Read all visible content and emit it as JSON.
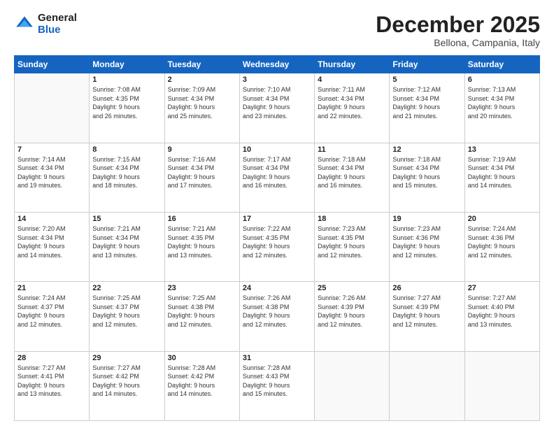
{
  "header": {
    "logo_general": "General",
    "logo_blue": "Blue",
    "month": "December 2025",
    "location": "Bellona, Campania, Italy"
  },
  "weekdays": [
    "Sunday",
    "Monday",
    "Tuesday",
    "Wednesday",
    "Thursday",
    "Friday",
    "Saturday"
  ],
  "weeks": [
    [
      {
        "day": "",
        "info": ""
      },
      {
        "day": "1",
        "info": "Sunrise: 7:08 AM\nSunset: 4:35 PM\nDaylight: 9 hours\nand 26 minutes."
      },
      {
        "day": "2",
        "info": "Sunrise: 7:09 AM\nSunset: 4:34 PM\nDaylight: 9 hours\nand 25 minutes."
      },
      {
        "day": "3",
        "info": "Sunrise: 7:10 AM\nSunset: 4:34 PM\nDaylight: 9 hours\nand 23 minutes."
      },
      {
        "day": "4",
        "info": "Sunrise: 7:11 AM\nSunset: 4:34 PM\nDaylight: 9 hours\nand 22 minutes."
      },
      {
        "day": "5",
        "info": "Sunrise: 7:12 AM\nSunset: 4:34 PM\nDaylight: 9 hours\nand 21 minutes."
      },
      {
        "day": "6",
        "info": "Sunrise: 7:13 AM\nSunset: 4:34 PM\nDaylight: 9 hours\nand 20 minutes."
      }
    ],
    [
      {
        "day": "7",
        "info": "Sunrise: 7:14 AM\nSunset: 4:34 PM\nDaylight: 9 hours\nand 19 minutes."
      },
      {
        "day": "8",
        "info": "Sunrise: 7:15 AM\nSunset: 4:34 PM\nDaylight: 9 hours\nand 18 minutes."
      },
      {
        "day": "9",
        "info": "Sunrise: 7:16 AM\nSunset: 4:34 PM\nDaylight: 9 hours\nand 17 minutes."
      },
      {
        "day": "10",
        "info": "Sunrise: 7:17 AM\nSunset: 4:34 PM\nDaylight: 9 hours\nand 16 minutes."
      },
      {
        "day": "11",
        "info": "Sunrise: 7:18 AM\nSunset: 4:34 PM\nDaylight: 9 hours\nand 16 minutes."
      },
      {
        "day": "12",
        "info": "Sunrise: 7:18 AM\nSunset: 4:34 PM\nDaylight: 9 hours\nand 15 minutes."
      },
      {
        "day": "13",
        "info": "Sunrise: 7:19 AM\nSunset: 4:34 PM\nDaylight: 9 hours\nand 14 minutes."
      }
    ],
    [
      {
        "day": "14",
        "info": "Sunrise: 7:20 AM\nSunset: 4:34 PM\nDaylight: 9 hours\nand 14 minutes."
      },
      {
        "day": "15",
        "info": "Sunrise: 7:21 AM\nSunset: 4:34 PM\nDaylight: 9 hours\nand 13 minutes."
      },
      {
        "day": "16",
        "info": "Sunrise: 7:21 AM\nSunset: 4:35 PM\nDaylight: 9 hours\nand 13 minutes."
      },
      {
        "day": "17",
        "info": "Sunrise: 7:22 AM\nSunset: 4:35 PM\nDaylight: 9 hours\nand 12 minutes."
      },
      {
        "day": "18",
        "info": "Sunrise: 7:23 AM\nSunset: 4:35 PM\nDaylight: 9 hours\nand 12 minutes."
      },
      {
        "day": "19",
        "info": "Sunrise: 7:23 AM\nSunset: 4:36 PM\nDaylight: 9 hours\nand 12 minutes."
      },
      {
        "day": "20",
        "info": "Sunrise: 7:24 AM\nSunset: 4:36 PM\nDaylight: 9 hours\nand 12 minutes."
      }
    ],
    [
      {
        "day": "21",
        "info": "Sunrise: 7:24 AM\nSunset: 4:37 PM\nDaylight: 9 hours\nand 12 minutes."
      },
      {
        "day": "22",
        "info": "Sunrise: 7:25 AM\nSunset: 4:37 PM\nDaylight: 9 hours\nand 12 minutes."
      },
      {
        "day": "23",
        "info": "Sunrise: 7:25 AM\nSunset: 4:38 PM\nDaylight: 9 hours\nand 12 minutes."
      },
      {
        "day": "24",
        "info": "Sunrise: 7:26 AM\nSunset: 4:38 PM\nDaylight: 9 hours\nand 12 minutes."
      },
      {
        "day": "25",
        "info": "Sunrise: 7:26 AM\nSunset: 4:39 PM\nDaylight: 9 hours\nand 12 minutes."
      },
      {
        "day": "26",
        "info": "Sunrise: 7:27 AM\nSunset: 4:39 PM\nDaylight: 9 hours\nand 12 minutes."
      },
      {
        "day": "27",
        "info": "Sunrise: 7:27 AM\nSunset: 4:40 PM\nDaylight: 9 hours\nand 13 minutes."
      }
    ],
    [
      {
        "day": "28",
        "info": "Sunrise: 7:27 AM\nSunset: 4:41 PM\nDaylight: 9 hours\nand 13 minutes."
      },
      {
        "day": "29",
        "info": "Sunrise: 7:27 AM\nSunset: 4:42 PM\nDaylight: 9 hours\nand 14 minutes."
      },
      {
        "day": "30",
        "info": "Sunrise: 7:28 AM\nSunset: 4:42 PM\nDaylight: 9 hours\nand 14 minutes."
      },
      {
        "day": "31",
        "info": "Sunrise: 7:28 AM\nSunset: 4:43 PM\nDaylight: 9 hours\nand 15 minutes."
      },
      {
        "day": "",
        "info": ""
      },
      {
        "day": "",
        "info": ""
      },
      {
        "day": "",
        "info": ""
      }
    ]
  ]
}
